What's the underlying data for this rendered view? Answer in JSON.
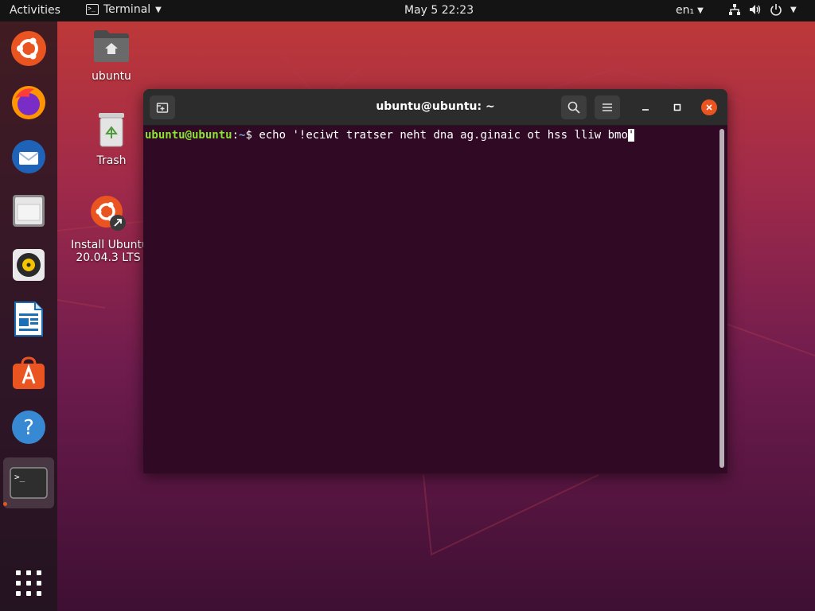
{
  "topbar": {
    "activities": "Activities",
    "app_name": "Terminal",
    "app_icon_glyph": ">_",
    "clock": "May 5  22:23",
    "language": "en₁",
    "icons": [
      "network-icon",
      "volume-icon",
      "power-icon",
      "system-menu-chevron-icon"
    ]
  },
  "dock": {
    "items": [
      "ubuntu-logo-icon",
      "firefox-icon",
      "thunderbird-icon",
      "files-icon",
      "rhythmbox-icon",
      "libreoffice-writer-icon",
      "software-center-icon",
      "help-icon",
      "terminal-icon",
      "show-apps-icon"
    ],
    "active": "terminal-icon",
    "terminal_glyph": ">_"
  },
  "desktop": {
    "home_label": "ubuntu",
    "trash_label": "Trash",
    "install_label_line1": "Install Ubuntu",
    "install_label_line2": "20.04.3 LTS"
  },
  "terminal": {
    "title": "ubuntu@ubuntu: ~",
    "prompt_user": "ubuntu@ubuntu",
    "prompt_sep": ":",
    "prompt_path": "~",
    "prompt_dollar": "$ ",
    "command": "echo '!eciwt tratser neht dna ag.ginaic ot hss lliw bmo",
    "cursor_char": "'"
  },
  "colors": {
    "accent": "#e95420",
    "terminal_bg": "#300a24",
    "prompt_user": "#8ae234",
    "prompt_path": "#729fcf"
  }
}
